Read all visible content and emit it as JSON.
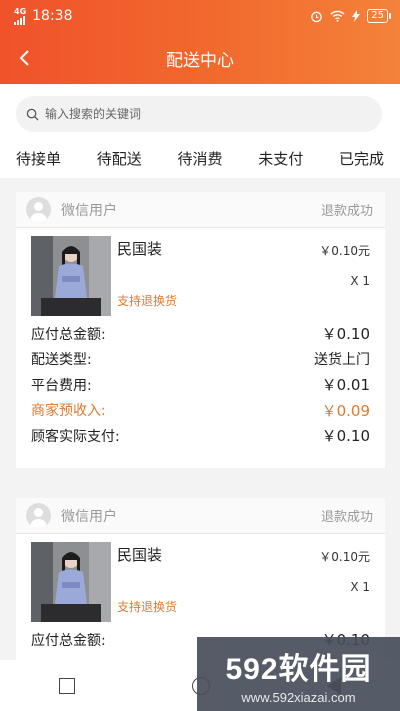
{
  "status_bar": {
    "network": "4G",
    "time": "18:38",
    "battery": "25"
  },
  "header": {
    "title": "配送中心"
  },
  "search": {
    "placeholder": "输入搜索的关键词"
  },
  "tabs": [
    {
      "label": "待接单"
    },
    {
      "label": "待配送"
    },
    {
      "label": "待消费"
    },
    {
      "label": "未支付"
    },
    {
      "label": "已完成"
    }
  ],
  "orders": [
    {
      "user": "微信用户",
      "status": "退款成功",
      "product": {
        "name": "民国装",
        "price": "￥0.10元",
        "qty": "X 1",
        "tag": "支持退换货"
      },
      "summary": [
        {
          "label": "应付总金额:",
          "value": "￥0.10"
        },
        {
          "label": "配送类型:",
          "value": "送货上门"
        },
        {
          "label": "平台费用:",
          "value": "￥0.01"
        },
        {
          "label": "商家预收入:",
          "value": "￥0.09"
        },
        {
          "label": "顾客实际支付:",
          "value": "￥0.10"
        }
      ]
    },
    {
      "user": "微信用户",
      "status": "退款成功",
      "product": {
        "name": "民国装",
        "price": "￥0.10元",
        "qty": "X 1",
        "tag": "支持退换货"
      },
      "summary": [
        {
          "label": "应付总金额:",
          "value": "￥0.10"
        }
      ]
    }
  ],
  "watermark": {
    "brand": "592软件园",
    "url": "www.592xiazai.com"
  },
  "colors": {
    "header_start": "#f0522a",
    "header_end": "#f4823a",
    "highlight": "#e07a30"
  }
}
